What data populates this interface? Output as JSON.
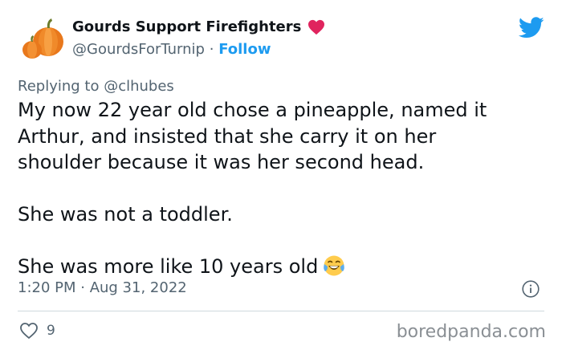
{
  "author": {
    "name": "Gourds Support Firefighters",
    "handle": "@GourdsForTurnip",
    "separator": "·",
    "follow_label": "Follow"
  },
  "reply": {
    "prefix": "Replying to",
    "to_handle": "@clhubes"
  },
  "tweet": {
    "lines": [
      "My now 22 year old chose a pineapple, named it",
      "Arthur, and insisted that she carry it on her",
      "shoulder because it was her second head.",
      "She was not a toddler.",
      "She was more like 10 years old"
    ]
  },
  "timestamp": "1:20 PM · Aug 31, 2022",
  "engagement": {
    "likes": "9"
  },
  "watermark": "boredpanda.com",
  "colors": {
    "accent": "#1d9bf0",
    "heart": "#e0245e",
    "muted": "#536471",
    "text": "#0f1419"
  },
  "icons": {
    "avatar": "pumpkin-avatar-icon",
    "name_badge": "red-heart-icon",
    "platform": "twitter-bird-icon",
    "emoji": "tears-of-joy-emoji-icon",
    "info": "info-icon",
    "like": "heart-outline-icon"
  }
}
